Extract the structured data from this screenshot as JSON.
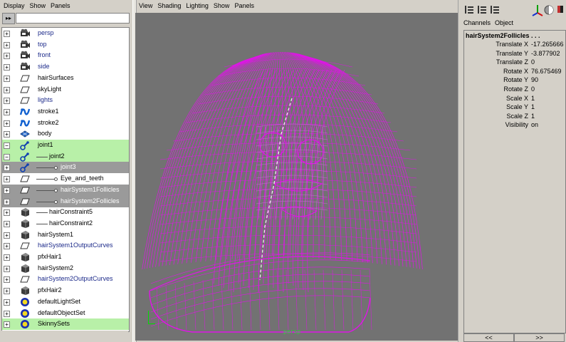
{
  "outliner": {
    "menu": [
      "Display",
      "Show",
      "Panels"
    ],
    "toolbar_glyph": "▸▸",
    "rows": [
      {
        "label": "persp",
        "icon": "camera-icon",
        "exp": "+",
        "indent": 0,
        "color": "blue",
        "hl": "none"
      },
      {
        "label": "top",
        "icon": "camera-icon",
        "exp": "+",
        "indent": 0,
        "color": "blue",
        "hl": "none"
      },
      {
        "label": "front",
        "icon": "camera-icon",
        "exp": "+",
        "indent": 0,
        "color": "blue",
        "hl": "none"
      },
      {
        "label": "side",
        "icon": "camera-icon",
        "exp": "+",
        "indent": 0,
        "color": "blue",
        "hl": "none"
      },
      {
        "label": "hairSurfaces",
        "icon": "set-icon",
        "exp": "+",
        "indent": 0,
        "color": "blk",
        "hl": "none"
      },
      {
        "label": "skyLight",
        "icon": "set-icon",
        "exp": "+",
        "indent": 0,
        "color": "blk",
        "hl": "none"
      },
      {
        "label": "lights",
        "icon": "set-icon",
        "exp": "+",
        "indent": 0,
        "color": "blue",
        "hl": "none"
      },
      {
        "label": "stroke1",
        "icon": "stroke-icon",
        "exp": "+",
        "indent": 0,
        "color": "blk",
        "hl": "none"
      },
      {
        "label": "stroke2",
        "icon": "stroke-icon",
        "exp": "+",
        "indent": 0,
        "color": "blk",
        "hl": "none"
      },
      {
        "label": "body",
        "icon": "mesh-icon",
        "exp": "+",
        "indent": 0,
        "color": "blk",
        "hl": "none"
      },
      {
        "label": "joint1",
        "icon": "joint-icon",
        "exp": "−",
        "indent": 0,
        "color": "blk",
        "hl": "green"
      },
      {
        "label": "joint2",
        "icon": "joint-icon",
        "exp": "−",
        "indent": 1,
        "color": "blk",
        "hl": "green"
      },
      {
        "label": "joint3",
        "icon": "joint-icon",
        "exp": "+",
        "indent": 2,
        "color": "wht",
        "hl": "gray"
      },
      {
        "label": "Eye_and_teeth",
        "icon": "set-icon",
        "exp": "+",
        "indent": 2,
        "color": "blk",
        "hl": "none"
      },
      {
        "label": "hairSystem1Follicles",
        "icon": "set-icon",
        "exp": "+",
        "indent": 2,
        "color": "wht",
        "hl": "gray"
      },
      {
        "label": "hairSystem2Follicles",
        "icon": "set-icon",
        "exp": "+",
        "indent": 2,
        "color": "wht",
        "hl": "gray"
      },
      {
        "label": "hairConstraint5",
        "icon": "cube-icon",
        "exp": "+",
        "indent": 1,
        "color": "blk",
        "hl": "none"
      },
      {
        "label": "hairConstraint2",
        "icon": "cube-icon",
        "exp": "+",
        "indent": 1,
        "color": "blk",
        "hl": "none"
      },
      {
        "label": "hairSystem1",
        "icon": "cube-icon",
        "exp": "+",
        "indent": 0,
        "color": "blk",
        "hl": "none"
      },
      {
        "label": "hairSystem1OutputCurves",
        "icon": "set-icon",
        "exp": "+",
        "indent": 0,
        "color": "blue",
        "hl": "none"
      },
      {
        "label": "pfxHair1",
        "icon": "cube-icon",
        "exp": "+",
        "indent": 0,
        "color": "blk",
        "hl": "none"
      },
      {
        "label": "hairSystem2",
        "icon": "cube-icon",
        "exp": "+",
        "indent": 0,
        "color": "blk",
        "hl": "none"
      },
      {
        "label": "hairSystem2OutputCurves",
        "icon": "set-icon",
        "exp": "+",
        "indent": 0,
        "color": "blue",
        "hl": "none"
      },
      {
        "label": "pfxHair2",
        "icon": "cube-icon",
        "exp": "+",
        "indent": 0,
        "color": "blk",
        "hl": "none"
      },
      {
        "label": "defaultLightSet",
        "icon": "lightset-icon",
        "exp": "+",
        "indent": 0,
        "color": "blk",
        "hl": "none"
      },
      {
        "label": "defaultObjectSet",
        "icon": "lightset-icon",
        "exp": "+",
        "indent": 0,
        "color": "blk",
        "hl": "none"
      },
      {
        "label": "SkinnySets",
        "icon": "lightset-icon",
        "exp": "+",
        "indent": 0,
        "color": "blk",
        "hl": "green"
      }
    ]
  },
  "viewport": {
    "menu": [
      "View",
      "Shading",
      "Lighting",
      "Show",
      "Panels"
    ],
    "camera_label": "persp"
  },
  "channel_box": {
    "tabs": [
      "Channels",
      "Object"
    ],
    "node_name": "hairSystem2Follicles . . .",
    "attrs": [
      {
        "name": "Translate X",
        "value": "-17.265666"
      },
      {
        "name": "Translate Y",
        "value": "-3.877902"
      },
      {
        "name": "Translate Z",
        "value": "0"
      },
      {
        "name": "Rotate X",
        "value": "76.675469"
      },
      {
        "name": "Rotate Y",
        "value": "90"
      },
      {
        "name": "Rotate Z",
        "value": "0"
      },
      {
        "name": "Scale X",
        "value": "1"
      },
      {
        "name": "Scale Y",
        "value": "1"
      },
      {
        "name": "Scale Z",
        "value": "1"
      },
      {
        "name": "Visibility",
        "value": "on"
      }
    ],
    "foot": [
      "<<",
      ">>"
    ]
  },
  "colors": {
    "hair_wire": "#e014e8",
    "viewport_bg": "#727272",
    "highlight_green": "#b8f0a8",
    "highlight_gray": "#9a9a9a"
  }
}
